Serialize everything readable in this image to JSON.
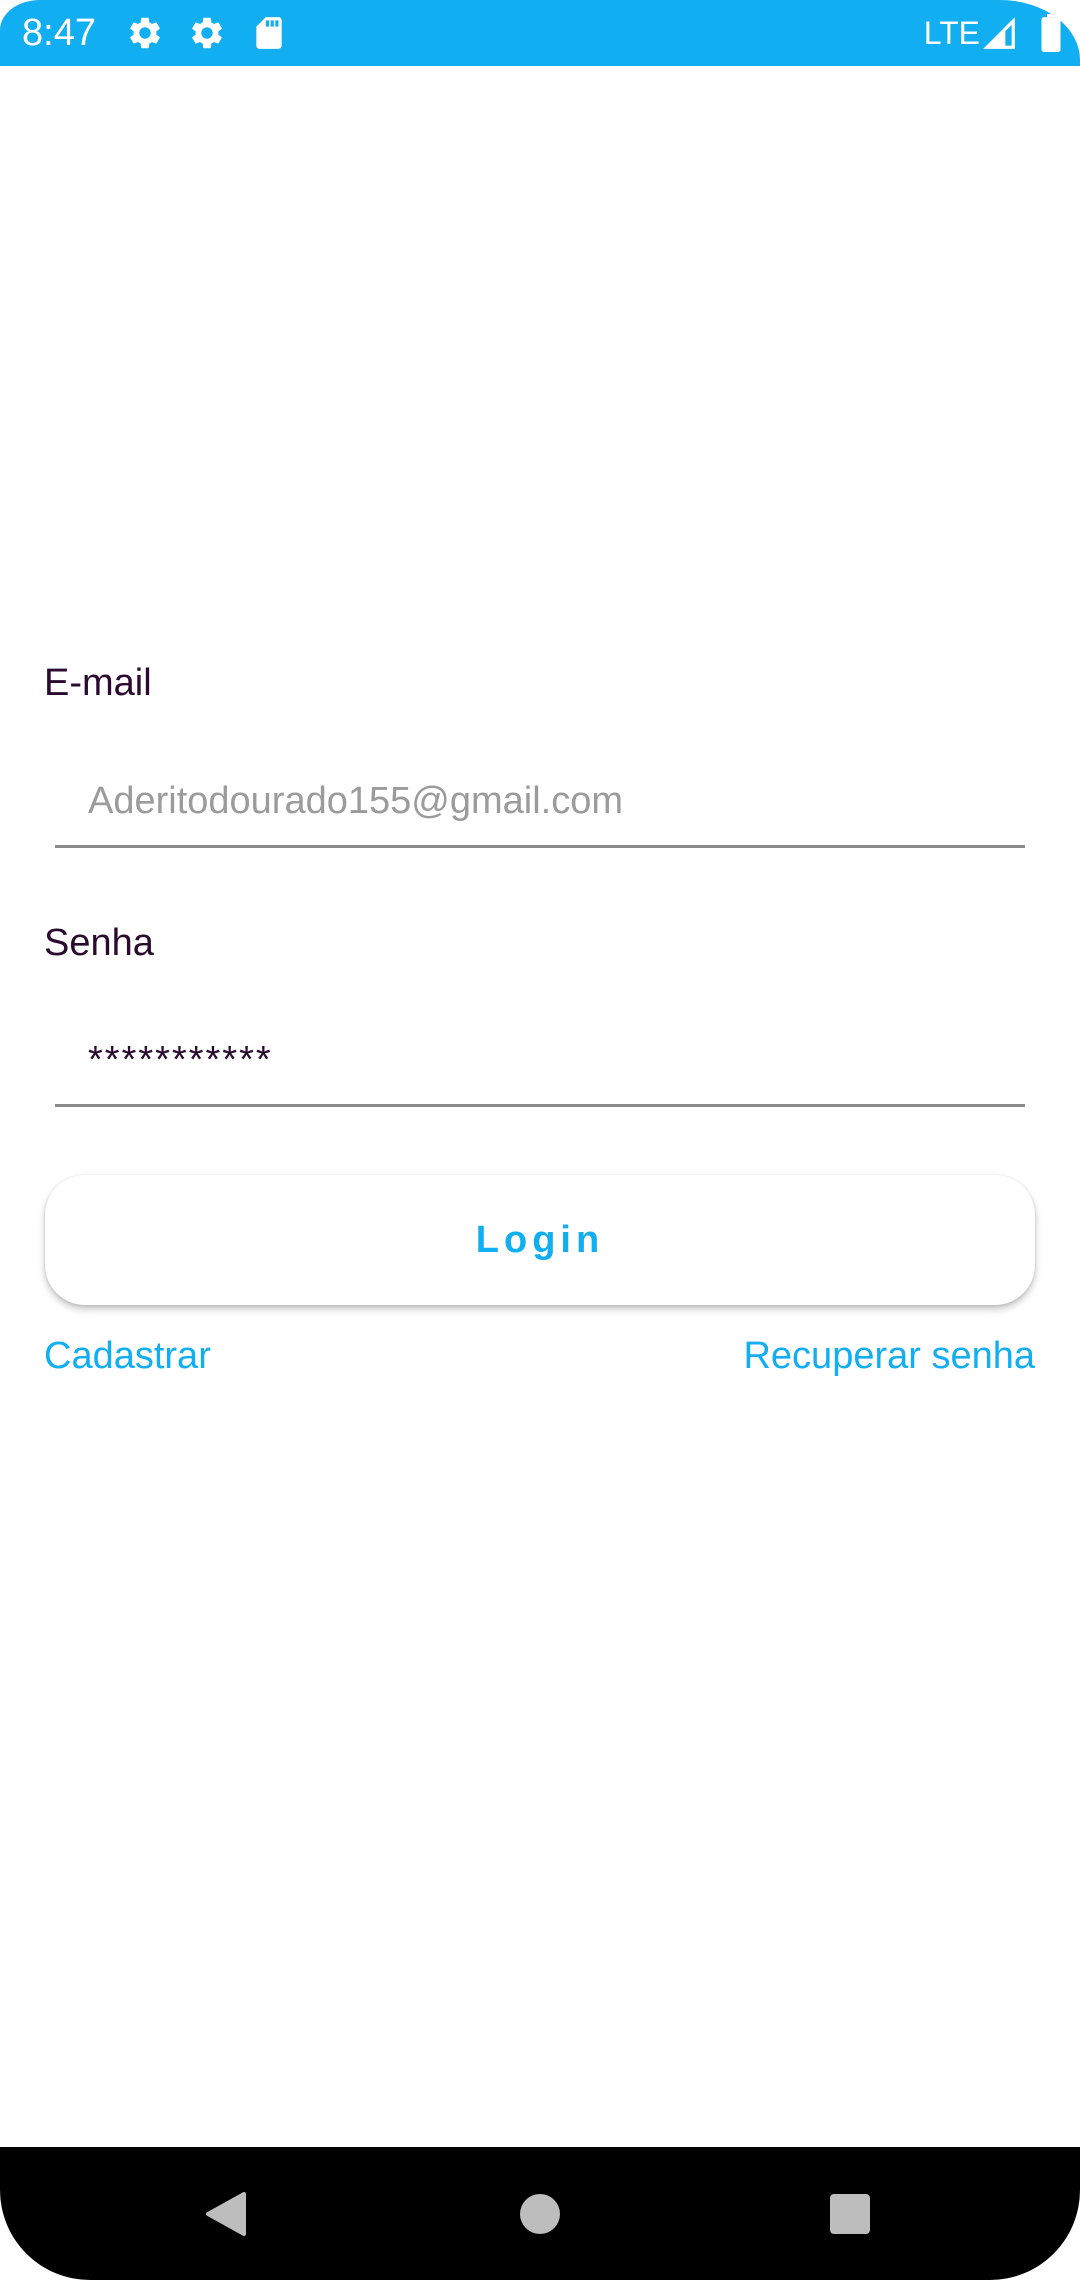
{
  "status_bar": {
    "time": "8:47",
    "network": "LTE",
    "color": "#12aef2",
    "icons": [
      "settings-icon",
      "settings-icon",
      "sd-card-icon",
      "signal-icon",
      "battery-icon"
    ]
  },
  "form": {
    "email": {
      "label": "E-mail",
      "placeholder": "Aderitodourado155@gmail.com"
    },
    "password": {
      "label": "Senha",
      "value": "***********"
    },
    "login_label": "Login",
    "register_label": "Cadastrar",
    "recover_label": "Recuperar senha"
  },
  "theme": {
    "accent": "#12aef2",
    "label_color": "#2a0a2e",
    "placeholder_color": "#9b9b9b"
  },
  "navigation": {
    "buttons": [
      "back-icon",
      "home-icon",
      "recents-icon"
    ]
  }
}
